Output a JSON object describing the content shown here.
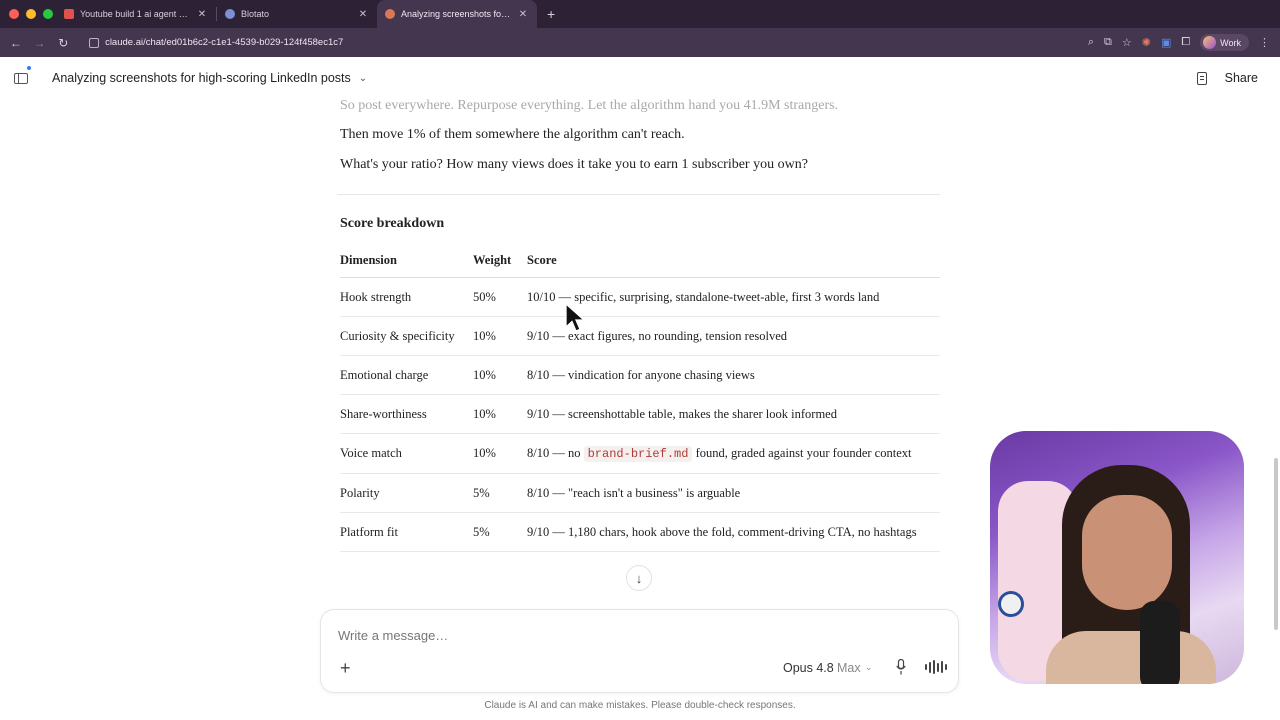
{
  "browser": {
    "tabs": [
      {
        "label": "Youtube build 1 ai agent m...",
        "active": false,
        "favicon_color": "#e0524f"
      },
      {
        "label": "Blotato",
        "active": false,
        "favicon_color": "#7d8fd6"
      },
      {
        "label": "Analyzing screenshots for hig...",
        "active": true,
        "favicon_color": "#d97757"
      }
    ],
    "url": "claude.ai/chat/ed01b6c2-c1e1-4539-b029-124f458ec1c7",
    "profile_label": "Work"
  },
  "header": {
    "chat_title": "Analyzing screenshots for high-scoring LinkedIn posts",
    "share_label": "Share"
  },
  "message": {
    "faded_line": "So post everywhere. Repurpose everything. Let the algorithm hand you 41.9M strangers.",
    "line1": "Then move 1% of them somewhere the algorithm can't reach.",
    "line2": "What's your ratio? How many views does it take you to earn 1 subscriber you own?",
    "section_heading": "Score breakdown"
  },
  "score_table": {
    "headers": {
      "dimension": "Dimension",
      "weight": "Weight",
      "score": "Score"
    },
    "rows": [
      {
        "dimension": "Hook strength",
        "weight": "50%",
        "score": "10/10 — specific, surprising, standalone-tweet-able, first 3 words land"
      },
      {
        "dimension": "Curiosity & specificity",
        "weight": "10%",
        "score": "9/10 — exact figures, no rounding, tension resolved"
      },
      {
        "dimension": "Emotional charge",
        "weight": "10%",
        "score": "8/10 — vindication for anyone chasing views"
      },
      {
        "dimension": "Share-worthiness",
        "weight": "10%",
        "score": "9/10 — screenshottable table, makes the sharer look informed"
      },
      {
        "dimension": "Voice match",
        "weight": "10%",
        "score_pre": "8/10 — no ",
        "score_code": "brand-brief.md",
        "score_post": " found, graded against your founder context"
      },
      {
        "dimension": "Polarity",
        "weight": "5%",
        "score": "8/10 — \"reach isn't a business\" is arguable"
      },
      {
        "dimension": "Platform fit",
        "weight": "5%",
        "score": "9/10 — 1,180 chars, hook above the fold, comment-driving CTA, no hashtags"
      }
    ]
  },
  "composer": {
    "placeholder": "Write a message…",
    "model": "Opus 4.8",
    "mode": "Max"
  },
  "disclaimer": "Claude is AI and can make mistakes. Please double-check responses."
}
